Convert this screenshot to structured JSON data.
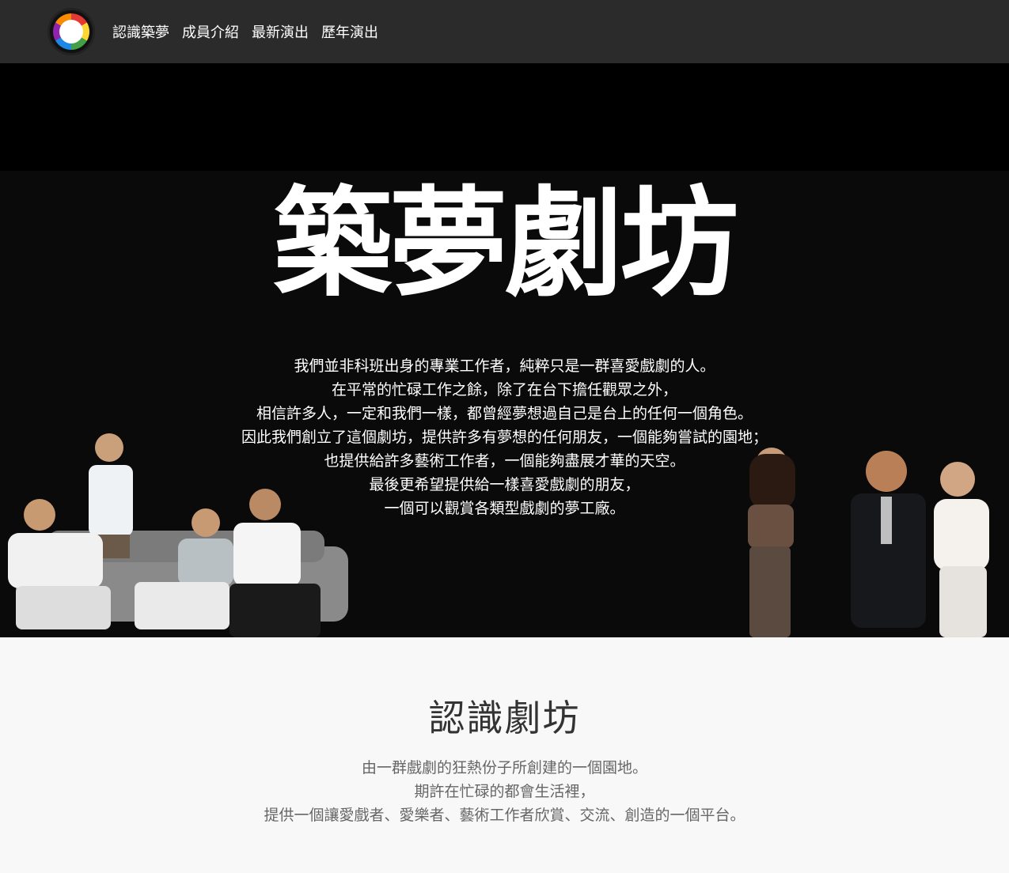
{
  "nav": {
    "logo_alt": "築夢劇坊 logo",
    "items": [
      {
        "label": "認識築夢"
      },
      {
        "label": "成員介紹"
      },
      {
        "label": "最新演出"
      },
      {
        "label": "歷年演出"
      }
    ]
  },
  "hero": {
    "title": "築夢劇坊",
    "lines": [
      "我們並非科班出身的專業工作者，純粹只是一群喜愛戲劇的人。",
      "在平常的忙碌工作之餘，除了在台下擔任觀眾之外，",
      "相信許多人，一定和我們一樣，都曾經夢想過自己是台上的任何一個角色。",
      "因此我們創立了這個劇坊，提供許多有夢想的任何朋友，一個能夠嘗試的園地；",
      "也提供給許多藝術工作者，一個能夠盡展才華的天空。",
      "最後更希望提供給一樣喜愛戲劇的朋友，",
      "一個可以觀賞各類型戲劇的夢工廠。"
    ]
  },
  "intro": {
    "title": "認識劇坊",
    "lines": [
      "由一群戲劇的狂熱份子所創建的一個園地。",
      "期許在忙碌的都會生活裡，",
      "提供一個讓愛戲者、愛樂者、藝術工作者欣賞、交流、創造的一個平台。"
    ]
  },
  "colors": {
    "navbar": "#2b2b2b",
    "hero": "#0a0a0a",
    "section_bg": "#f8f8f8"
  }
}
